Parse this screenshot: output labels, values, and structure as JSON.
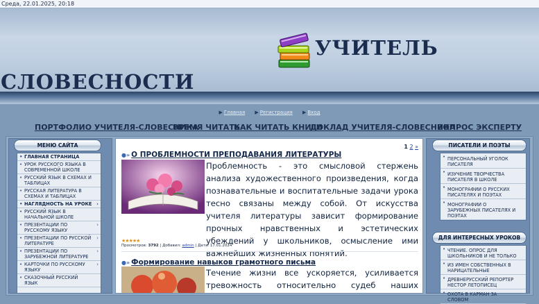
{
  "topbar": {
    "date_time": "Среда, 22.01.2025, 20:18"
  },
  "header": {
    "title_line1": "УЧИТЕЛЬ",
    "title_line2": "СЛОВЕСНОСТИ"
  },
  "utility_nav": [
    {
      "label": "Главная"
    },
    {
      "label": "Регистрация"
    },
    {
      "label": "Вход"
    }
  ],
  "main_nav": [
    {
      "label": "ПОРТФОЛИО УЧИТЕЛЯ-СЛОВЕСНИКА"
    },
    {
      "label": "ВРЕМЯ ЧИТАТЬ"
    },
    {
      "label": "КАК ЧИТАТЬ КНИГИ"
    },
    {
      "label": "ДОКЛАД УЧИТЕЛЯ-СЛОВЕСНИКА"
    },
    {
      "label": "ВОПРОС ЭКСПЕРТУ"
    }
  ],
  "left_menu": {
    "title": "МЕНЮ САЙТА",
    "items": [
      {
        "label": "ГЛАВНАЯ СТРАНИЦА",
        "bold": true
      },
      {
        "label": "УРОК РУССКОГО ЯЗЫКА В СОВРЕМЕННОЙ ШКОЛЕ"
      },
      {
        "label": "РУССКИЙ ЯЗЫК В СХЕМАХ И ТАБЛИЦАХ"
      },
      {
        "label": "РУССКАЯ ЛИТЕРАТУРА В СХЕМАХ И ТАБЛИЦАХ"
      },
      {
        "label": "НАГЛЯДНОСТЬ НА УРОКЕ",
        "bold": true
      },
      {
        "label": "РУССКИЙ ЯЗЫК В НАЧАЛЬНОЙ ШКОЛЕ"
      },
      {
        "label": "ПРЕЗЕНТАЦИИ ПО РУССКОМУ ЯЗЫКУ"
      },
      {
        "label": "ПРЕЗЕНТАЦИИ ПО РУССКОЙ ЛИТЕРАТУРЕ"
      },
      {
        "label": "ПРЕЗЕНТАЦИИ ПО ЗАРУБЕЖНОЙ ЛИТЕРАТУРЕ"
      },
      {
        "label": "КАРТОЧКИ ПО РУССКОМУ ЯЗЫКУ"
      },
      {
        "label": "СКАЗОЧНЫЙ РУССКИЙ ЯЗЫК"
      }
    ]
  },
  "center": {
    "pager": {
      "current": "1",
      "page2": "2",
      "next": "»"
    },
    "posts": [
      {
        "title": "О ПРОБЛЕМНОСТИ ПРЕПОДАВАНИЯ ЛИТЕРАТУРЫ",
        "text": "Проблемность - это смысловой стержень анализа художественного произведения, когда познавательные и воспитательные задачи урока тесно связаны между собой. От искусства учителя литературы зависит формирование прочных нравственных и эстетических убеждений у школьников, осмысление ими важнейших жизненных понятий.",
        "rating_stars": 5,
        "meta_views_label": "Просмотров: ",
        "meta_views": "3792",
        "meta_sep1": " | Добавил: ",
        "meta_author": "admin",
        "meta_sep2": " | Дата: ",
        "meta_date": "17.01.2024"
      },
      {
        "title": "Формирование навыков грамотного письма",
        "text": "Течение жизни все ускоряется, усиливается тревожность относительно судеб наших духовных ценностей"
      }
    ]
  },
  "right_blocks": [
    {
      "title": "ПИСАТЕЛИ И ПОЭТЫ",
      "items": [
        {
          "label": "ПЕРСОНАЛЬНЫЙ УГОЛОК ПИСАТЕЛЯ"
        },
        {
          "label": "ИЗУЧЕНИЕ ТВОРЧЕСТВА ПИСАТЕЛЯ В ШКОЛЕ"
        },
        {
          "label": "МОНОГРАФИИ О РУССКИХ ПИСАТЕЛЯХ И ПОЭТАХ"
        },
        {
          "label": "МОНОГРАФИИ О ЗАРУБЕЖНЫХ ПИСАТЕЛЯХ И ПОЭТАХ"
        }
      ]
    },
    {
      "title": "ДЛЯ ИНТЕРЕСНЫХ УРОКОВ",
      "items": [
        {
          "label": "ЧТЕНИЕ. ОПРОС ДЛЯ ШКОЛЬНИКОВ И НЕ ТОЛЬКО"
        },
        {
          "label": "ИЗ ИМЕН СОБСТВЕННЫХ В НАРИЦАТЕЛЬНЫЕ"
        },
        {
          "label": "ДРЕВНЕРУССКИЙ РЕПОРТЕР НЕСТОР ЛЕТОПИСЕЦ"
        },
        {
          "label": "ОХОТА В КАРМАН ЗА СЛОВОМ"
        }
      ]
    }
  ],
  "icons": {
    "logo": "books-stack-icon",
    "bullet": "bullet-icon",
    "submenu": "chevron-right-icon",
    "arrow": "triangle-right-icon",
    "post_marker": "post-marker-icon",
    "rating": "star-icon"
  },
  "colors": {
    "page_bg": "#7f9ab7",
    "header_blue": "#a7bbd2",
    "title_text": "#1b2d4e",
    "link_blue": "#2546a3",
    "star": "#e08f1a"
  }
}
